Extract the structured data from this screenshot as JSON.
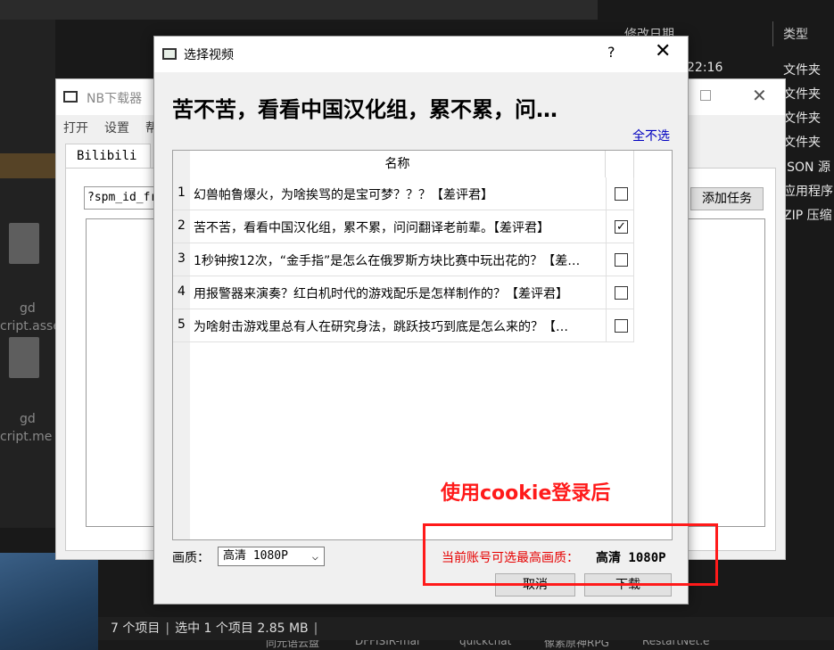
{
  "explorer": {
    "columns": {
      "modified": "修改日期",
      "type": "类型"
    },
    "first_time": "22:16",
    "types": [
      "文件夹",
      "文件夹",
      "文件夹",
      "文件夹",
      "JSON 源",
      "应用程序",
      "ZIP 压缩"
    ],
    "desktop_items": [
      "gd",
      "cript.asse",
      "gd",
      "cript.me"
    ],
    "status": {
      "count": "7 个项目",
      "selected": "选中 1 个项目  2.85 MB"
    },
    "taskbar": [
      "同元语云盘",
      "DFFISIR-mai",
      "quickchat",
      "像素原神RPG",
      "RestartNet.e"
    ]
  },
  "main_window": {
    "title": "NB下载器",
    "menu": [
      "打开",
      "设置",
      "帮"
    ],
    "tab": "Bilibili",
    "url_value": "?spm_id_fr",
    "add_task_label": "添加任务"
  },
  "dialog": {
    "title": "选择视频",
    "help": "?",
    "close": "✕",
    "heading": "苦不苦，看看中国汉化组，累不累，问…",
    "deselect_all": "全不选",
    "column_name": "名称",
    "videos": [
      {
        "num": "1",
        "title": "幻兽帕鲁爆火，为啥挨骂的是宝可梦？？？【差评君】",
        "checked": false,
        "mark": ""
      },
      {
        "num": "2",
        "title": "苦不苦，看看中国汉化组，累不累，问问翻译老前辈。【差评君】",
        "checked": true,
        "mark": "✓"
      },
      {
        "num": "3",
        "title": "1秒钟按12次，“金手指”是怎么在俄罗斯方块比赛中玩出花的？【差…",
        "checked": false,
        "mark": ""
      },
      {
        "num": "4",
        "title": "用报警器来演奏？红白机时代的游戏配乐是怎样制作的？【差评君】",
        "checked": false,
        "mark": ""
      },
      {
        "num": "5",
        "title": "为啥射击游戏里总有人在研究身法，跳跃技巧到底是怎么来的？【…",
        "checked": false,
        "mark": ""
      }
    ],
    "quality_label": "画质：",
    "quality_value": "高清 1080P",
    "max_quality_label": "当前账号可选最高画质：",
    "max_quality_value": "高清 1080P",
    "cancel": "取消",
    "download": "下载"
  },
  "annotation": {
    "text": "使用cookie登录后",
    "color": "#ff1a1a"
  }
}
